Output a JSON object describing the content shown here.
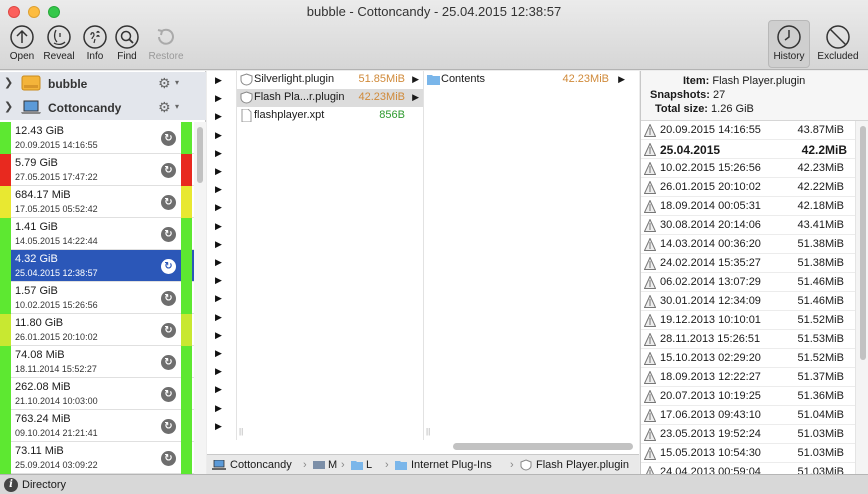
{
  "window": {
    "title": "bubble - Cottoncandy - 25.04.2015 12:38:57"
  },
  "toolbar": {
    "open": "Open",
    "reveal": "Reveal",
    "info": "Info",
    "find": "Find",
    "restore": "Restore",
    "history": "History",
    "excluded": "Excluded"
  },
  "volumes": [
    {
      "name": "bubble",
      "icon": "external-disk-icon"
    },
    {
      "name": "Cottoncandy",
      "icon": "laptop-icon"
    }
  ],
  "snapshots": [
    {
      "size": "12.43 GiB",
      "date": "20.09.2015 14:16:55",
      "color": "#5de831"
    },
    {
      "size": "5.79 GiB",
      "date": "27.05.2015 17:47:22",
      "color": "#e8291f"
    },
    {
      "size": "684.17 MiB",
      "date": "17.05.2015 05:52:42",
      "color": "#e8e831"
    },
    {
      "size": "1.41 GiB",
      "date": "14.05.2015 14:22:44",
      "color": "#5de831"
    },
    {
      "size": "4.32 GiB",
      "date": "25.04.2015 12:38:57",
      "color": "#5de831",
      "selected": true
    },
    {
      "size": "1.57 GiB",
      "date": "10.02.2015 15:26:56",
      "color": "#5de831"
    },
    {
      "size": "11.80 GiB",
      "date": "26.01.2015 20:10:02",
      "color": "#c8e831"
    },
    {
      "size": "74.08 MiB",
      "date": "18.11.2014 15:52:27",
      "color": "#5de831"
    },
    {
      "size": "262.08 MiB",
      "date": "21.10.2014 10:03:00",
      "color": "#5de831"
    },
    {
      "size": "763.24 MiB",
      "date": "09.10.2014 21:21:41",
      "color": "#5de831"
    },
    {
      "size": "73.11 MiB",
      "date": "25.09.2014 03:09:22",
      "color": "#5de831"
    }
  ],
  "browser": {
    "col1": [
      {
        "name": "Silverlight.plugin",
        "size": "51.85MiB",
        "icon": "plugin-icon",
        "size_color": "#d08a3a"
      },
      {
        "name": "Flash Pla...r.plugin",
        "size": "42.23MiB",
        "icon": "plugin-icon",
        "size_color": "#d08a3a",
        "selected": true
      },
      {
        "name": "flashplayer.xpt",
        "size": "856B",
        "icon": "document-icon",
        "size_color": "#2e9a2e"
      }
    ],
    "col2": [
      {
        "name": "Contents",
        "size": "42.23MiB",
        "icon": "folder-icon",
        "size_color": "#d08a3a"
      }
    ]
  },
  "pathbar": {
    "root": "Cottoncandy",
    "s1": "M",
    "s2": "L",
    "s3": "Internet Plug-Ins",
    "s4": "Flash Player.plugin"
  },
  "info": {
    "item_label": "Item:",
    "item": "Flash Player.plugin",
    "snapshots_label": "Snapshots:",
    "snapshots": "27",
    "total_label": "Total size:",
    "total": "1.26 GiB"
  },
  "history": [
    {
      "date": "20.09.2015 14:16:55",
      "value": "43.87",
      "unit": "MiB"
    },
    {
      "date": "25.04.2015",
      "value": "42.2",
      "unit": "MiB",
      "bold": true
    },
    {
      "date": "10.02.2015 15:26:56",
      "value": "42.23",
      "unit": "MiB"
    },
    {
      "date": "26.01.2015 20:10:02",
      "value": "42.22",
      "unit": "MiB"
    },
    {
      "date": "18.09.2014 00:05:31",
      "value": "42.18",
      "unit": "MiB"
    },
    {
      "date": "30.08.2014 20:14:06",
      "value": "43.41",
      "unit": "MiB"
    },
    {
      "date": "14.03.2014 00:36:20",
      "value": "51.38",
      "unit": "MiB"
    },
    {
      "date": "24.02.2014 15:35:27",
      "value": "51.38",
      "unit": "MiB"
    },
    {
      "date": "06.02.2014 13:07:29",
      "value": "51.46",
      "unit": "MiB"
    },
    {
      "date": "30.01.2014 12:34:09",
      "value": "51.46",
      "unit": "MiB"
    },
    {
      "date": "19.12.2013 10:10:01",
      "value": "51.52",
      "unit": "MiB"
    },
    {
      "date": "28.11.2013 15:26:51",
      "value": "51.53",
      "unit": "MiB"
    },
    {
      "date": "15.10.2013 02:29:20",
      "value": "51.52",
      "unit": "MiB"
    },
    {
      "date": "18.09.2013 12:22:27",
      "value": "51.37",
      "unit": "MiB"
    },
    {
      "date": "20.07.2013 10:19:25",
      "value": "51.36",
      "unit": "MiB"
    },
    {
      "date": "17.06.2013 09:43:10",
      "value": "51.04",
      "unit": "MiB"
    },
    {
      "date": "23.05.2013 19:52:24",
      "value": "51.03",
      "unit": "MiB"
    },
    {
      "date": "15.05.2013 10:54:30",
      "value": "51.03",
      "unit": "MiB"
    },
    {
      "date": "24.04.2013 00:59:04",
      "value": "51.03",
      "unit": "MiB"
    }
  ],
  "status": {
    "text": "Directory"
  }
}
